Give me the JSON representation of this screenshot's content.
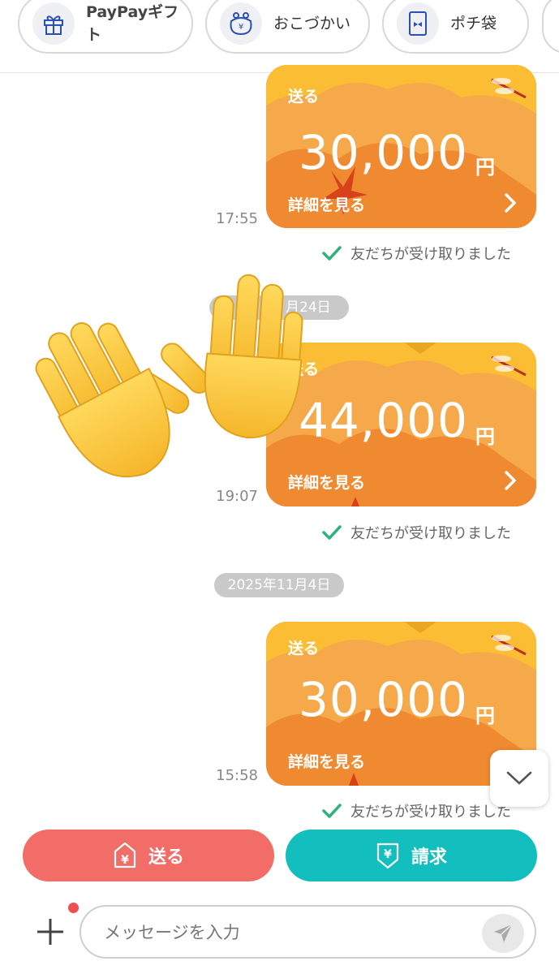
{
  "chips": [
    {
      "label": "PayPayギフト",
      "icon": "gift-icon"
    },
    {
      "label": "おこづかい",
      "icon": "coin-purse-icon"
    },
    {
      "label": "ポチ袋",
      "icon": "envelope-icon"
    }
  ],
  "messages": [
    {
      "send_label": "送る",
      "amount": "30,000",
      "currency": "円",
      "detail_label": "詳細を見る",
      "time": "17:55",
      "status": "友だちが受け取りました"
    },
    {
      "send_label": "送る",
      "amount": "44,000",
      "currency": "円",
      "detail_label": "詳細を見る",
      "time": "19:07",
      "status": "友だちが受け取りました"
    },
    {
      "send_label": "送る",
      "amount": "30,000",
      "currency": "円",
      "detail_label": "詳細を見る",
      "time": "15:58",
      "status": "友だちが受け取りました"
    }
  ],
  "dates": [
    "2025年11月4日"
  ],
  "date_partial": "月24日",
  "actions": {
    "send_label": "送る",
    "request_label": "請求"
  },
  "composer": {
    "placeholder": "メッセージを入力"
  },
  "colors": {
    "send_button": "#f26d67",
    "request_button": "#12bfbe",
    "card": "#f5a347",
    "check": "#2fb27c",
    "notification_dot": "#ee4f4f"
  }
}
